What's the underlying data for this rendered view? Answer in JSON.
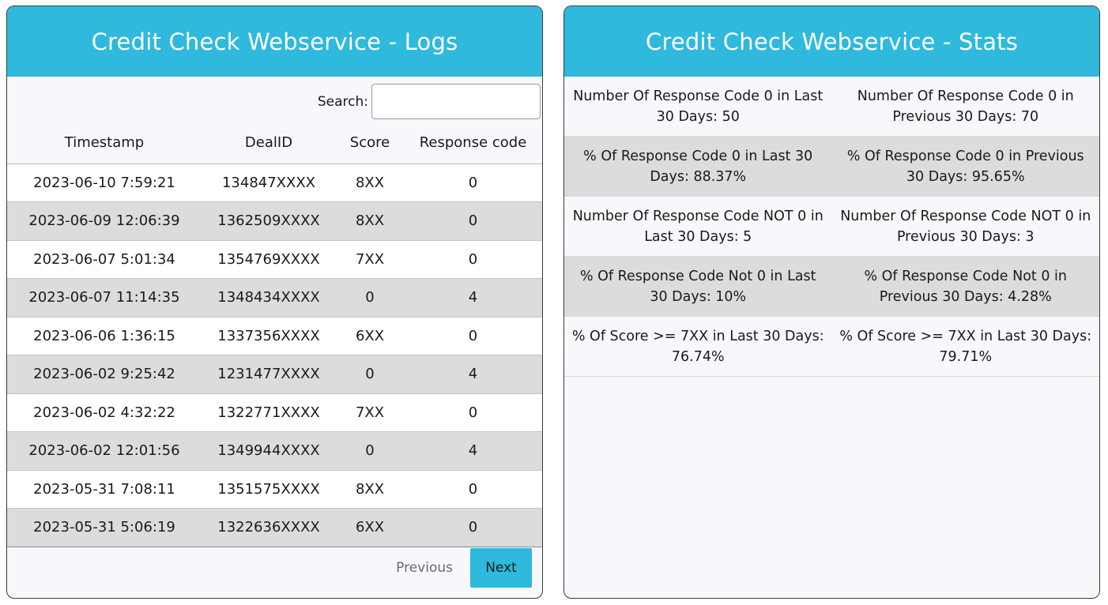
{
  "logs": {
    "title": "Credit Check Webservice - Logs",
    "search_label": "Search:",
    "search_value": "",
    "columns": [
      "Timestamp",
      "DealID",
      "Score",
      "Response code"
    ],
    "rows": [
      [
        "2023-06-10 7:59:21",
        "134847XXXX",
        "8XX",
        "0"
      ],
      [
        "2023-06-09 12:06:39",
        "1362509XXXX",
        "8XX",
        "0"
      ],
      [
        "2023-06-07 5:01:34",
        "1354769XXXX",
        "7XX",
        "0"
      ],
      [
        "2023-06-07 11:14:35",
        "1348434XXXX",
        "0",
        "4"
      ],
      [
        "2023-06-06 1:36:15",
        "1337356XXXX",
        "6XX",
        "0"
      ],
      [
        "2023-06-02 9:25:42",
        "1231477XXXX",
        "0",
        "4"
      ],
      [
        "2023-06-02 4:32:22",
        "1322771XXXX",
        "7XX",
        "0"
      ],
      [
        "2023-06-02 12:01:56",
        "1349944XXXX",
        "0",
        "4"
      ],
      [
        "2023-05-31 7:08:11",
        "1351575XXXX",
        "8XX",
        "0"
      ],
      [
        "2023-05-31 5:06:19",
        "1322636XXXX",
        "6XX",
        "0"
      ]
    ],
    "pager": {
      "previous_label": "Previous",
      "next_label": "Next"
    }
  },
  "stats": {
    "title": "Credit Check Webservice - Stats",
    "rows": [
      [
        "Number Of Response Code 0 in Last 30 Days: 50",
        "Number Of Response Code 0 in Previous 30 Days: 70"
      ],
      [
        "% Of Response Code 0 in Last 30 Days: 88.37%",
        "% Of Response Code 0 in Previous 30 Days: 95.65%"
      ],
      [
        "Number Of Response Code NOT 0 in Last 30 Days: 5",
        "Number Of Response Code NOT 0 in Previous 30 Days: 3"
      ],
      [
        "% Of Response Code Not 0 in Last 30 Days: 10%",
        "% Of Response Code Not 0 in Previous 30 Days: 4.28%"
      ],
      [
        "% Of Score >= 7XX in Last 30 Days: 76.74%",
        "% Of Score >= 7XX in Last 30 Days: 79.71%"
      ]
    ]
  },
  "colors": {
    "header": "#2eb9dd",
    "stripe": "#dcdcdc",
    "panel_bg": "#f7f8fc"
  }
}
